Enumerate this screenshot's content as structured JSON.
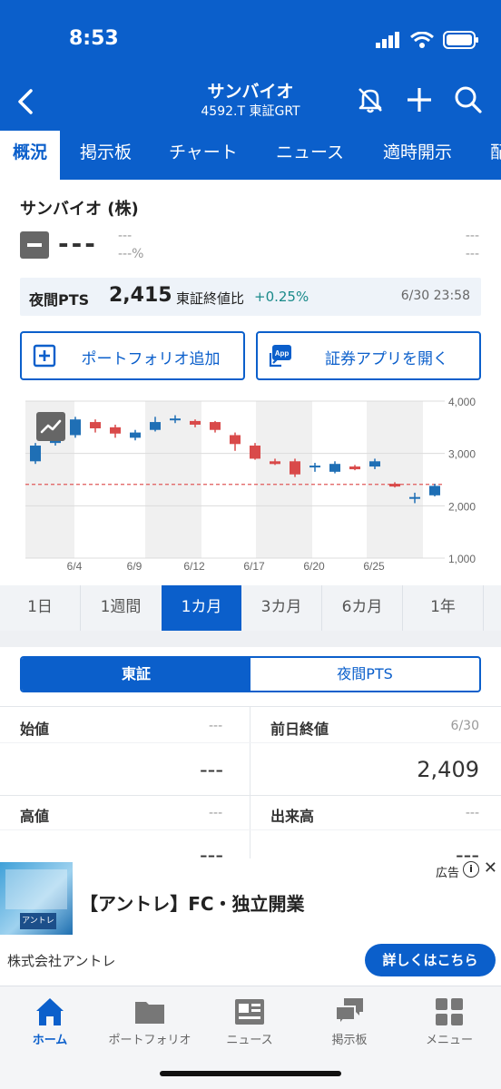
{
  "status": {
    "time": "8:53"
  },
  "header": {
    "title": "サンバイオ",
    "subtitle": "4592.T 東証GRT"
  },
  "tabs": [
    {
      "label": "概況",
      "active": true
    },
    {
      "label": "掲示板"
    },
    {
      "label": "チャート"
    },
    {
      "label": "ニュース"
    },
    {
      "label": "適時開示"
    },
    {
      "label": "配"
    }
  ],
  "stock": {
    "name": "サンバイオ (株)",
    "price": "---",
    "change": "---",
    "change_pct": "---%",
    "right_top": "---",
    "right_bottom": "---"
  },
  "pts": {
    "label": "夜間PTS",
    "price": "2,415",
    "compare_label": "東証終値比",
    "compare_pct": "+0.25%",
    "time": "6/30 23:58"
  },
  "buttons": {
    "portfolio_add": "ポートフォリオ追加",
    "open_app": "証券アプリを開く",
    "app_icon_text": "App"
  },
  "chart_data": {
    "type": "candlestick",
    "title": "",
    "x_tick_labels": [
      "6/4",
      "6/9",
      "6/12",
      "6/17",
      "6/20",
      "6/25"
    ],
    "y_tick_labels": [
      "4,000",
      "3,000",
      "2,000",
      "1,000"
    ],
    "ylim": [
      1000,
      4000
    ],
    "reference_line": 2409,
    "colors": {
      "up": "#1f6fb5",
      "down": "#d94a4a",
      "ref": "#e05a5a"
    },
    "candles": [
      {
        "open": 2850,
        "close": 3150,
        "high": 3200,
        "low": 2800
      },
      {
        "open": 3200,
        "close": 3350,
        "high": 3550,
        "low": 3150
      },
      {
        "open": 3350,
        "close": 3650,
        "high": 3700,
        "low": 3300
      },
      {
        "open": 3600,
        "close": 3480,
        "high": 3650,
        "low": 3400
      },
      {
        "open": 3500,
        "close": 3380,
        "high": 3550,
        "low": 3300
      },
      {
        "open": 3300,
        "close": 3400,
        "high": 3450,
        "low": 3250
      },
      {
        "open": 3450,
        "close": 3600,
        "high": 3700,
        "low": 3420
      },
      {
        "open": 3650,
        "close": 3650,
        "high": 3730,
        "low": 3580
      },
      {
        "open": 3620,
        "close": 3550,
        "high": 3650,
        "low": 3500
      },
      {
        "open": 3600,
        "close": 3450,
        "high": 3620,
        "low": 3400
      },
      {
        "open": 3350,
        "close": 3180,
        "high": 3400,
        "low": 3050
      },
      {
        "open": 3150,
        "close": 2900,
        "high": 3200,
        "low": 2880
      },
      {
        "open": 2850,
        "close": 2820,
        "high": 2900,
        "low": 2780
      },
      {
        "open": 2850,
        "close": 2600,
        "high": 2900,
        "low": 2550
      },
      {
        "open": 2750,
        "close": 2750,
        "high": 2820,
        "low": 2650
      },
      {
        "open": 2650,
        "close": 2800,
        "high": 2850,
        "low": 2620
      },
      {
        "open": 2750,
        "close": 2720,
        "high": 2780,
        "low": 2680
      },
      {
        "open": 2750,
        "close": 2850,
        "high": 2900,
        "low": 2700
      },
      {
        "open": 2420,
        "close": 2380,
        "high": 2450,
        "low": 2350
      },
      {
        "open": 2150,
        "close": 2150,
        "high": 2250,
        "low": 2050
      },
      {
        "open": 2200,
        "close": 2380,
        "high": 2420,
        "low": 2180
      }
    ]
  },
  "period_tabs": [
    {
      "label": "1日"
    },
    {
      "label": "1週間"
    },
    {
      "label": "1カ月",
      "active": true
    },
    {
      "label": "3カ月"
    },
    {
      "label": "6カ月"
    },
    {
      "label": "1年"
    }
  ],
  "market_segment": {
    "tse": "東証",
    "pts": "夜間PTS"
  },
  "quote_cells": {
    "open_label": "始値",
    "open_meta": "---",
    "open_value": "---",
    "prev_close_label": "前日終値",
    "prev_close_meta": "6/30",
    "prev_close_value": "2,409",
    "high_label": "高値",
    "high_meta": "---",
    "high_value": "---",
    "volume_label": "出来高",
    "volume_meta": "---",
    "volume_value": "---"
  },
  "ad": {
    "label": "広告",
    "title": "【アントレ】FC・独立開業",
    "company": "株式会社アントレ",
    "cta": "詳しくはこちら",
    "thumb_badge": "アントレ"
  },
  "bottom_nav": [
    {
      "label": "ホーム",
      "icon": "home-icon",
      "active": true
    },
    {
      "label": "ポートフォリオ",
      "icon": "folder-icon"
    },
    {
      "label": "ニュース",
      "icon": "newspaper-icon"
    },
    {
      "label": "掲示板",
      "icon": "chat-icon"
    },
    {
      "label": "メニュー",
      "icon": "grid-menu-icon"
    }
  ]
}
